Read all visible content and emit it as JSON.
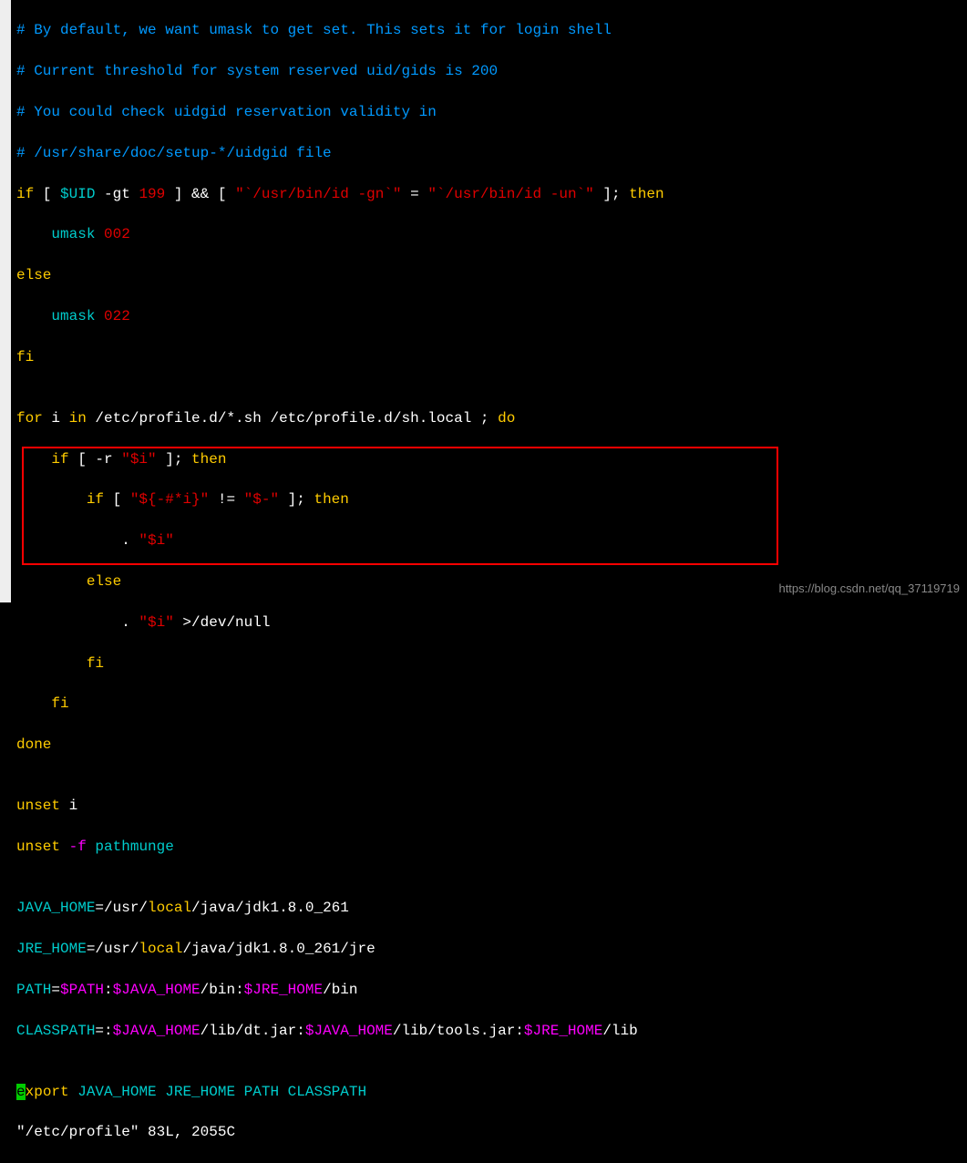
{
  "lines": {
    "l1_comment": "# By default, we want umask to get set. This sets it for login shell",
    "l2_comment": "# Current threshold for system reserved uid/gids is 200",
    "l3_comment": "# You could check uidgid reservation validity in",
    "l4_comment": "# /usr/share/doc/setup-*/uidgid file",
    "l5": {
      "if": "if",
      "b1": " [ ",
      "uid": "$UID",
      "gt": " -gt ",
      "n199": "199",
      "b2": " ] && [ ",
      "q1": "\"`/usr/bin/id -gn`\"",
      "eq": " = ",
      "q2": "\"`/usr/bin/id -un`\"",
      "b3": " ]; ",
      "then": "then"
    },
    "l6": {
      "indent": "    ",
      "umask": "umask ",
      "val": "002"
    },
    "l7": {
      "else": "else"
    },
    "l8": {
      "indent": "    ",
      "umask": "umask ",
      "val": "022"
    },
    "l9": {
      "fi": "fi"
    },
    "l10": "",
    "l11": {
      "for": "for",
      "sp1": " i ",
      "in": "in",
      "sp2": " /etc/profile.d/*.sh /etc/profile.d/sh.local ; ",
      "do": "do"
    },
    "l12": {
      "indent": "    ",
      "if": "if",
      "b1": " [ -r ",
      "q": "\"$i\"",
      "b2": " ]; ",
      "then": "then"
    },
    "l13": {
      "indent": "        ",
      "if": "if",
      "b1": " [ ",
      "q1": "\"${-#*i}\"",
      "ne": " != ",
      "q2": "\"$-\"",
      "b2": " ]; ",
      "then": "then"
    },
    "l14": {
      "indent": "            ",
      "dot": ". ",
      "q": "\"$i\""
    },
    "l15": {
      "indent": "        ",
      "else": "else"
    },
    "l16": {
      "indent": "            ",
      "dot": ". ",
      "q": "\"$i\"",
      "redir": " >/dev/null"
    },
    "l17": {
      "indent": "        ",
      "fi": "fi"
    },
    "l18": {
      "indent": "    ",
      "fi": "fi"
    },
    "l19": {
      "done": "done"
    },
    "l20": "",
    "l21": {
      "unset": "unset",
      "arg": " i"
    },
    "l22": {
      "unset": "unset",
      "flag": " -f",
      "arg": " pathmunge"
    },
    "l23": "",
    "l24": {
      "var": "JAVA_HOME",
      "eq": "=/usr/",
      "local": "local",
      "rest": "/java/jdk1.8.0_261"
    },
    "l25": {
      "var": "JRE_HOME",
      "eq": "=/usr/",
      "local": "local",
      "rest": "/java/jdk1.8.0_261/jre"
    },
    "l26": {
      "var": "PATH",
      "eq": "=",
      "path": "$PATH",
      "c1": ":",
      "jh": "$JAVA_HOME",
      "bin1": "/bin:",
      "jre": "$JRE_HOME",
      "bin2": "/bin"
    },
    "l27": {
      "var": "CLASSPATH",
      "eq": "=:",
      "jh1": "$JAVA_HOME",
      "p1": "/lib/dt.jar:",
      "jh2": "$JAVA_HOME",
      "p2": "/lib/tools.jar:",
      "jre": "$JRE_HOME",
      "p3": "/lib"
    },
    "l28": "",
    "l29": {
      "cursor": "e",
      "export": "xport",
      "vars": " JAVA_HOME JRE_HOME PATH CLASSPATH"
    },
    "status": "\"/etc/profile\" 83L, 2055C"
  },
  "watermark": "https://blog.csdn.net/qq_37119719"
}
